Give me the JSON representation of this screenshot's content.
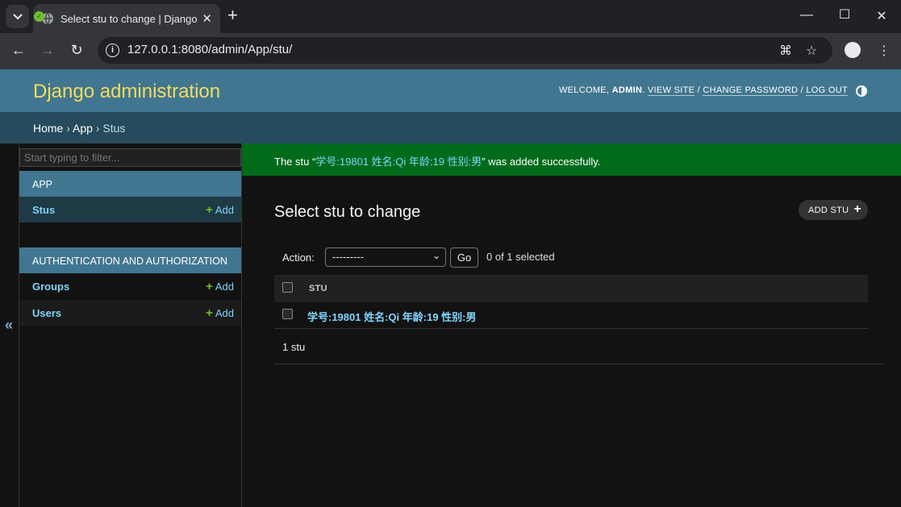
{
  "browser": {
    "tab_title": "Select stu to change | Django site admin",
    "url": "127.0.0.1:8080/admin/App/stu/"
  },
  "header": {
    "site_name": "Django administration",
    "welcome": "WELCOME,",
    "username": "ADMIN",
    "view_site": "VIEW SITE",
    "change_password": "CHANGE PASSWORD",
    "log_out": "LOG OUT"
  },
  "breadcrumbs": {
    "home": "Home",
    "app": "App",
    "current": "Stus",
    "separator": "›"
  },
  "sidebar": {
    "filter_placeholder": "Start typing to filter...",
    "apps": [
      {
        "caption": "APP",
        "models": [
          {
            "name": "Stus",
            "add": "Add"
          }
        ]
      },
      {
        "caption": "AUTHENTICATION AND AUTHORIZATION",
        "models": [
          {
            "name": "Groups",
            "add": "Add"
          },
          {
            "name": "Users",
            "add": "Add"
          }
        ]
      }
    ],
    "collapse_glyph": "«"
  },
  "message": {
    "prefix": "The stu “",
    "object": "学号:19801 姓名:Qi 年龄:19 性别:男",
    "suffix": "” was added successfully."
  },
  "main": {
    "title": "Select stu to change",
    "add_button": "ADD STU",
    "action_label": "Action:",
    "action_selected": "---------",
    "go_button": "Go",
    "selection_counter": "0 of 1 selected",
    "column_header": "STU",
    "rows": [
      "学号:19801 姓名:Qi 年龄:19 性别:男"
    ],
    "paginator": "1 stu"
  },
  "colors": {
    "header_bg": "#417690",
    "breadcrumbs_bg": "#264b5d",
    "success_bg": "#006b1b",
    "link": "#81d4fa",
    "branding": "#f5dd5d"
  }
}
